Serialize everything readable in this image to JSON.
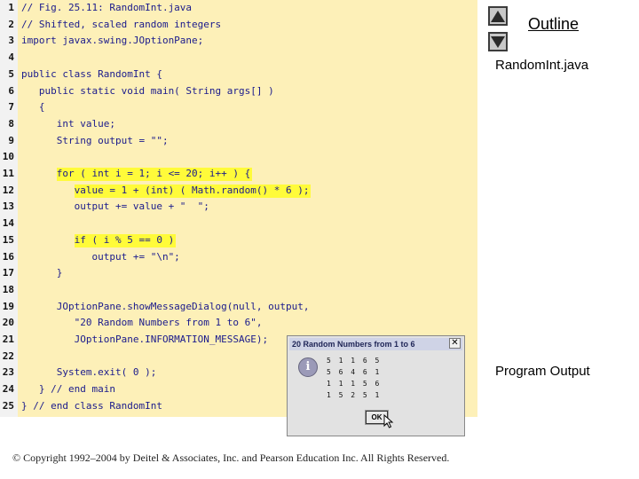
{
  "code_lines": [
    {
      "num": "1",
      "text": "// Fig. 25.11: RandomInt.java",
      "highlight": false
    },
    {
      "num": "2",
      "text": "// Shifted, scaled random integers",
      "highlight": false
    },
    {
      "num": "3",
      "text": "import javax.swing.JOptionPane;",
      "highlight": false
    },
    {
      "num": "4",
      "text": "",
      "highlight": false
    },
    {
      "num": "5",
      "text": "public class RandomInt {",
      "highlight": false
    },
    {
      "num": "6",
      "text": "   public static void main( String args[] )",
      "highlight": false
    },
    {
      "num": "7",
      "text": "   {",
      "highlight": false
    },
    {
      "num": "8",
      "text": "      int value;",
      "highlight": false
    },
    {
      "num": "9",
      "text": "      String output = \"\";",
      "highlight": false
    },
    {
      "num": "10",
      "text": "",
      "highlight": false
    },
    {
      "num": "11",
      "text": "      for ( int i = 1; i <= 20; i++ ) {",
      "highlight": true
    },
    {
      "num": "12",
      "text": "         value = 1 + (int) ( Math.random() * 6 );",
      "highlight": true
    },
    {
      "num": "13",
      "text": "         output += value + \"  \";",
      "highlight": false
    },
    {
      "num": "14",
      "text": "",
      "highlight": false
    },
    {
      "num": "15",
      "text": "         if ( i % 5 == 0 )",
      "highlight": true
    },
    {
      "num": "16",
      "text": "            output += \"\\n\";",
      "highlight": false
    },
    {
      "num": "17",
      "text": "      }",
      "highlight": false
    },
    {
      "num": "18",
      "text": "",
      "highlight": false
    },
    {
      "num": "19",
      "text": "      JOptionPane.showMessageDialog(null, output,",
      "highlight": false
    },
    {
      "num": "20",
      "text": "         \"20 Random Numbers from 1 to 6\",",
      "highlight": false
    },
    {
      "num": "21",
      "text": "         JOptionPane.INFORMATION_MESSAGE);",
      "highlight": false
    },
    {
      "num": "22",
      "text": "",
      "highlight": false
    },
    {
      "num": "23",
      "text": "      System.exit( 0 );",
      "highlight": false
    },
    {
      "num": "24",
      "text": "   } // end main",
      "highlight": false
    },
    {
      "num": "25",
      "text": "} // end class RandomInt",
      "highlight": false
    }
  ],
  "sidebar": {
    "outline_label": "Outline",
    "file_label": "RandomInt.java",
    "output_label": "Program Output"
  },
  "dialog": {
    "title": "20 Random Numbers from 1 to 6",
    "close_glyph": "✕",
    "icon_glyph": "i",
    "rows": [
      "5 1 1 6 5",
      "5 6 4 6 1",
      "1 1 1 5 6",
      "1 5 2 5 1"
    ],
    "ok_label": "OK"
  },
  "footer": {
    "copyright": "© Copyright 1992–2004 by Deitel & Associates, Inc. and Pearson Education Inc. All Rights Reserved."
  },
  "colors": {
    "code_background": "#fdf0b8",
    "highlight": "#fffb3a",
    "code_text": "#1a1a8c"
  }
}
